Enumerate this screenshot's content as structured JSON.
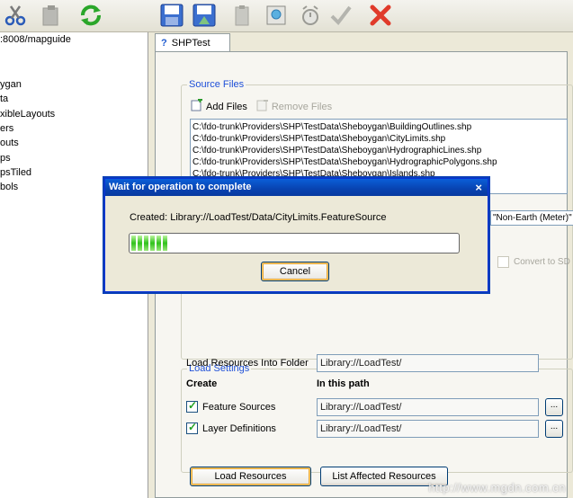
{
  "toolbar": {
    "icons": [
      "scissors-icon",
      "paste-icon",
      "refresh-icon",
      "save-icon",
      "save-as-icon",
      "clipboard-icon",
      "preview-icon",
      "timer-icon",
      "validate-icon",
      "delete-icon"
    ]
  },
  "tree": {
    "server": ":8008/mapguide",
    "items": [
      "ygan",
      "ta",
      "xibleLayouts",
      "ers",
      "outs",
      "ps",
      "psTiled",
      "bols"
    ]
  },
  "tab": {
    "label": "SHPTest",
    "icon": "question-icon"
  },
  "source_files": {
    "legend": "Source Files",
    "add_files": "Add Files",
    "remove_files": "Remove Files",
    "files": [
      "C:\\fdo-trunk\\Providers\\SHP\\TestData\\Sheboygan\\BuildingOutlines.shp",
      "C:\\fdo-trunk\\Providers\\SHP\\TestData\\Sheboygan\\CityLimits.shp",
      "C:\\fdo-trunk\\Providers\\SHP\\TestData\\Sheboygan\\HydrographicLines.shp",
      "C:\\fdo-trunk\\Providers\\SHP\\TestData\\Sheboygan\\HydrographicPolygons.shp",
      "C:\\fdo-trunk\\Providers\\SHP\\TestData\\Sheboygan\\Islands.shp"
    ]
  },
  "coord_value": "\"Non-Earth (Meter)\"",
  "convert_label": "Convert to SD",
  "load_settings": {
    "legend": "Load Settings",
    "folder_label": "Load Resources Into Folder",
    "folder_value": "Library://LoadTest/",
    "create_header": "Create",
    "path_header": "In this path",
    "rows": [
      {
        "label": "Feature Sources",
        "path": "Library://LoadTest/",
        "checked": true
      },
      {
        "label": "Layer Definitions",
        "path": "Library://LoadTest/",
        "checked": true
      }
    ],
    "browse": "..."
  },
  "buttons": {
    "load": "Load Resources",
    "list": "List Affected Resources"
  },
  "dialog": {
    "title": "Wait for operation to complete",
    "close": "×",
    "message": "Created: Library://LoadTest/Data/CityLimits.FeatureSource",
    "progress_segments": 6,
    "cancel": "Cancel"
  },
  "watermark": "http://www.mgdn.com.cn"
}
